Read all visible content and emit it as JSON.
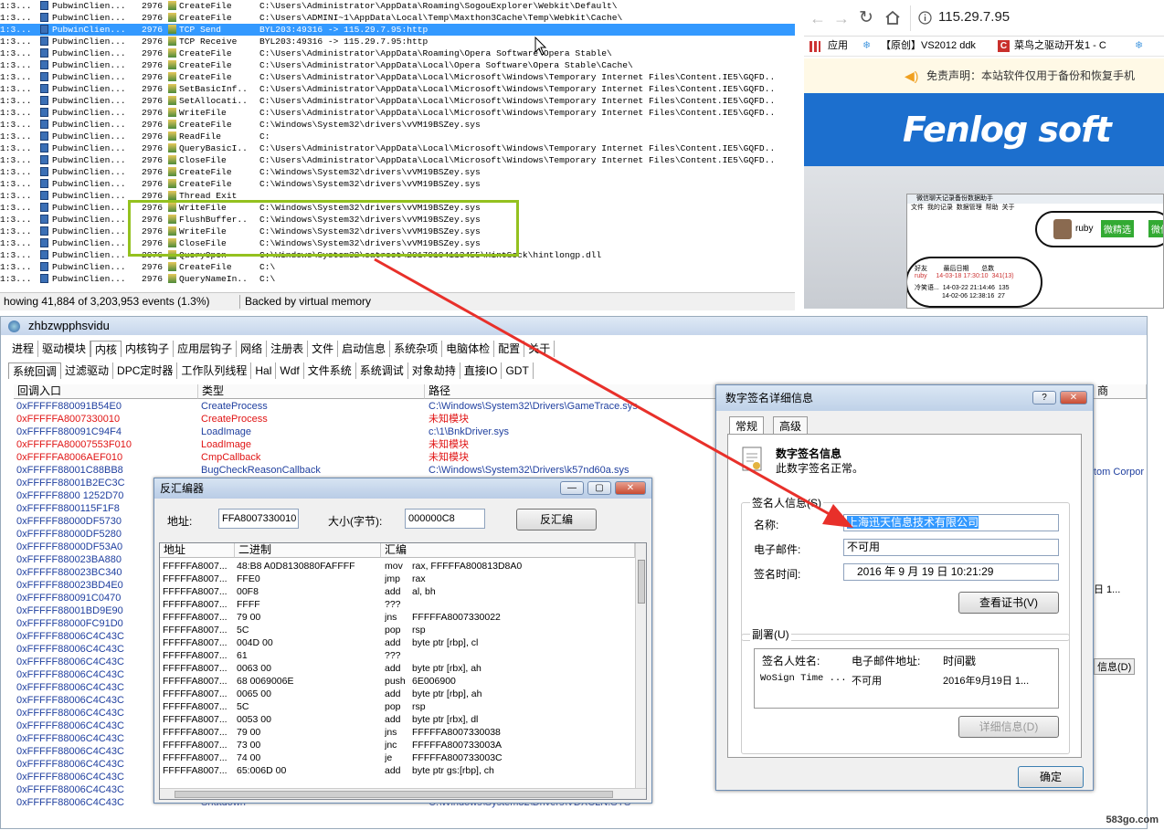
{
  "procmon": {
    "rows": [
      {
        "time": "1:3...",
        "proc": "PubwinClien...",
        "pid": "2976",
        "op": "CreateFile",
        "path": "C:\\Users\\Administrator\\AppData\\Roaming\\SogouExplorer\\Webkit\\Default\\",
        "icon": "file-icon"
      },
      {
        "time": "1:3...",
        "proc": "PubwinClien...",
        "pid": "2976",
        "op": "CreateFile",
        "path": "C:\\Users\\ADMINI~1\\AppData\\Local\\Temp\\Maxthon3Cache\\Temp\\Webkit\\Cache\\",
        "icon": "file-icon"
      },
      {
        "time": "1:3...",
        "proc": "PubwinClien...",
        "pid": "2976",
        "op": "TCP Send",
        "path": "BYL203:49316 -> 115.29.7.95:http",
        "icon": "network-icon",
        "selected": true
      },
      {
        "time": "1:3...",
        "proc": "PubwinClien...",
        "pid": "2976",
        "op": "TCP Receive",
        "path": "BYL203:49316 -> 115.29.7.95:http",
        "icon": "network-icon"
      },
      {
        "time": "1:3...",
        "proc": "PubwinClien...",
        "pid": "2976",
        "op": "CreateFile",
        "path": "C:\\Users\\Administrator\\AppData\\Roaming\\Opera Software\\Opera Stable\\",
        "icon": "file-icon"
      },
      {
        "time": "1:3...",
        "proc": "PubwinClien...",
        "pid": "2976",
        "op": "CreateFile",
        "path": "C:\\Users\\Administrator\\AppData\\Local\\Opera Software\\Opera Stable\\Cache\\",
        "icon": "file-icon"
      },
      {
        "time": "1:3...",
        "proc": "PubwinClien...",
        "pid": "2976",
        "op": "CreateFile",
        "path": "C:\\Users\\Administrator\\AppData\\Local\\Microsoft\\Windows\\Temporary Internet Files\\Content.IE5\\GQFD..",
        "icon": "file-icon"
      },
      {
        "time": "1:3...",
        "proc": "PubwinClien...",
        "pid": "2976",
        "op": "SetBasicInf...",
        "path": "C:\\Users\\Administrator\\AppData\\Local\\Microsoft\\Windows\\Temporary Internet Files\\Content.IE5\\GQFD..",
        "icon": "file-icon"
      },
      {
        "time": "1:3...",
        "proc": "PubwinClien...",
        "pid": "2976",
        "op": "SetAllocati...",
        "path": "C:\\Users\\Administrator\\AppData\\Local\\Microsoft\\Windows\\Temporary Internet Files\\Content.IE5\\GQFD..",
        "icon": "file-icon"
      },
      {
        "time": "1:3...",
        "proc": "PubwinClien...",
        "pid": "2976",
        "op": "WriteFile",
        "path": "C:\\Users\\Administrator\\AppData\\Local\\Microsoft\\Windows\\Temporary Internet Files\\Content.IE5\\GQFD..",
        "icon": "file-icon"
      },
      {
        "time": "1:3...",
        "proc": "PubwinClien...",
        "pid": "2976",
        "op": "CreateFile",
        "path": "C:\\Windows\\System32\\drivers\\vVM19BSZey.sys",
        "icon": "file-icon"
      },
      {
        "time": "1:3...",
        "proc": "PubwinClien...",
        "pid": "2976",
        "op": "ReadFile",
        "path": "C:",
        "icon": "file-icon"
      },
      {
        "time": "1:3...",
        "proc": "PubwinClien...",
        "pid": "2976",
        "op": "QueryBasicI...",
        "path": "C:\\Users\\Administrator\\AppData\\Local\\Microsoft\\Windows\\Temporary Internet Files\\Content.IE5\\GQFD..",
        "icon": "file-icon"
      },
      {
        "time": "1:3...",
        "proc": "PubwinClien...",
        "pid": "2976",
        "op": "CloseFile",
        "path": "C:\\Users\\Administrator\\AppData\\Local\\Microsoft\\Windows\\Temporary Internet Files\\Content.IE5\\GQFD..",
        "icon": "file-icon"
      },
      {
        "time": "1:3...",
        "proc": "PubwinClien...",
        "pid": "2976",
        "op": "CreateFile",
        "path": "C:\\Windows\\System32\\drivers\\vVM19BSZey.sys",
        "icon": "file-icon"
      },
      {
        "time": "1:3...",
        "proc": "PubwinClien...",
        "pid": "2976",
        "op": "CreateFile",
        "path": "C:\\Windows\\System32\\drivers\\vVM19BSZey.sys",
        "icon": "file-icon"
      },
      {
        "time": "1:3...",
        "proc": "PubwinClien...",
        "pid": "2976",
        "op": "Thread Exit",
        "path": "",
        "icon": "thread-icon"
      },
      {
        "time": "1:3...",
        "proc": "PubwinClien...",
        "pid": "2976",
        "op": "WriteFile",
        "path": "C:\\Windows\\System32\\drivers\\vVM19BSZey.sys",
        "icon": "file-icon"
      },
      {
        "time": "1:3...",
        "proc": "PubwinClien...",
        "pid": "2976",
        "op": "FlushBuffer...",
        "path": "C:\\Windows\\System32\\drivers\\vVM19BSZey.sys",
        "icon": "file-icon"
      },
      {
        "time": "1:3...",
        "proc": "PubwinClien...",
        "pid": "2976",
        "op": "WriteFile",
        "path": "C:\\Windows\\System32\\drivers\\vVM19BSZey.sys",
        "icon": "file-icon"
      },
      {
        "time": "1:3...",
        "proc": "PubwinClien...",
        "pid": "2976",
        "op": "CloseFile",
        "path": "C:\\Windows\\System32\\drivers\\vVM19BSZey.sys",
        "icon": "file-icon"
      },
      {
        "time": "1:3...",
        "proc": "PubwinClien...",
        "pid": "2976",
        "op": "QueryOpen",
        "path": "C:\\Windows\\System32\\catroot\\20170104113455\\HintSock\\hintlongp.dll",
        "icon": "file-icon"
      },
      {
        "time": "1:3...",
        "proc": "PubwinClien...",
        "pid": "2976",
        "op": "CreateFile",
        "path": "C:\\",
        "icon": "file-icon"
      },
      {
        "time": "1:3...",
        "proc": "PubwinClien...",
        "pid": "2976",
        "op": "QueryNameIn...",
        "path": "C:\\",
        "icon": "file-icon"
      }
    ],
    "status_events": "howing 41,884 of 3,203,953 events (1.3%)",
    "status_memory": "Backed by virtual memory"
  },
  "browser": {
    "url": "115.29.7.95",
    "bookmarks": [
      "应用",
      "【原创】VS2012 ddk",
      "菜鸟之驱动开发1 - C"
    ],
    "notice": "免责声明：本站软件仅用于备份和恢复手机",
    "brand_logo": "Fenlog soft",
    "shot": {
      "title": "微信聊天记录备份数据助手",
      "menu": [
        "文件",
        "我的记录",
        "数据管理",
        "帮助",
        "关于"
      ],
      "user": "ruby",
      "btn_pick": "微精选",
      "btn_wx": "微信",
      "list_headers": [
        "好友",
        "最后日期",
        "总数"
      ],
      "list_rows": [
        [
          "ruby",
          "14-03-18 17:30:10",
          "341(13)"
        ],
        [
          "冷笑语...",
          "14-03-22 21:14:46",
          "135"
        ],
        [
          "",
          "14-02-06 12:38:16",
          "27"
        ]
      ]
    }
  },
  "tool": {
    "title": "zhbzwpphsvidu",
    "tabs": [
      "进程",
      "驱动模块",
      "内核",
      "内核钩子",
      "应用层钩子",
      "网络",
      "注册表",
      "文件",
      "启动信息",
      "系统杂项",
      "电脑体检",
      "配置",
      "关于"
    ],
    "active_tab": 2,
    "subtabs": [
      "系统回调",
      "过滤驱动",
      "DPC定时器",
      "工作队列线程",
      "Hal",
      "Wdf",
      "文件系统",
      "系统调试",
      "对象劫持",
      "直接IO",
      "GDT"
    ],
    "columns": [
      "回调入口",
      "类型",
      "路径"
    ],
    "rows": [
      {
        "addr": "0xFFFFF880091B54E0",
        "type": "CreateProcess",
        "path": "C:\\Windows\\System32\\Drivers\\GameTrace.sys",
        "red": false
      },
      {
        "addr": "0xFFFFFA8007330010",
        "type": "CreateProcess",
        "path": "未知模块",
        "red": true
      },
      {
        "addr": "0xFFFFF880091C94F4",
        "type": "LoadImage",
        "path": "c:\\1\\BnkDriver.sys",
        "red": false
      },
      {
        "addr": "0xFFFFFA80007553F010",
        "type": "LoadImage",
        "path": "未知模块",
        "red": true
      },
      {
        "addr": "0xFFFFFA8006AEF010",
        "type": "CmpCallback",
        "path": "未知模块",
        "red": true
      },
      {
        "addr": "0xFFFFF88001C88BB8",
        "type": "BugCheckReasonCallback",
        "path": "C:\\Windows\\System32\\Drivers\\k57nd60a.sys",
        "red": false
      },
      {
        "addr": "0xFFFFF88001B2EC3C",
        "type": "",
        "path": "",
        "red": false
      },
      {
        "addr": "0xFFFFF8800 1252D70",
        "type": "",
        "path": "",
        "red": false
      },
      {
        "addr": "0xFFFFF8800115F1F8",
        "type": "",
        "path": "",
        "red": false
      },
      {
        "addr": "0xFFFFF88000DF5730",
        "type": "",
        "path": "",
        "red": false
      },
      {
        "addr": "0xFFFFF88000DF5280",
        "type": "",
        "path": "",
        "red": false
      },
      {
        "addr": "0xFFFFF88000DF53A0",
        "type": "",
        "path": "",
        "red": false
      },
      {
        "addr": "0xFFFFF880023BA880",
        "type": "",
        "path": "",
        "red": false
      },
      {
        "addr": "0xFFFFF880023BC340",
        "type": "",
        "path": "",
        "red": false
      },
      {
        "addr": "0xFFFFF880023BD4E0",
        "type": "",
        "path": "",
        "red": false
      },
      {
        "addr": "0xFFFFF880091C0470",
        "type": "",
        "path": "",
        "red": false
      },
      {
        "addr": "0xFFFFF88001BD9E90",
        "type": "",
        "path": "",
        "red": false
      },
      {
        "addr": "0xFFFFF88000FC91D0",
        "type": "",
        "path": "",
        "red": false
      },
      {
        "addr": "0xFFFFF88006C4C43C",
        "type": "",
        "path": "",
        "red": false
      },
      {
        "addr": "0xFFFFF88006C4C43C",
        "type": "",
        "path": "",
        "red": false
      },
      {
        "addr": "0xFFFFF88006C4C43C",
        "type": "",
        "path": "",
        "red": false
      },
      {
        "addr": "0xFFFFF88006C4C43C",
        "type": "",
        "path": "",
        "red": false
      },
      {
        "addr": "0xFFFFF88006C4C43C",
        "type": "",
        "path": "",
        "red": false
      },
      {
        "addr": "0xFFFFF88006C4C43C",
        "type": "",
        "path": "",
        "red": false
      },
      {
        "addr": "0xFFFFF88006C4C43C",
        "type": "",
        "path": "",
        "red": false
      },
      {
        "addr": "0xFFFFF88006C4C43C",
        "type": "",
        "path": "",
        "red": false
      },
      {
        "addr": "0xFFFFF88006C4C43C",
        "type": "",
        "path": "",
        "red": false
      },
      {
        "addr": "0xFFFFF88006C4C43C",
        "type": "",
        "path": "",
        "red": false
      },
      {
        "addr": "0xFFFFF88006C4C43C",
        "type": "",
        "path": "",
        "red": false
      },
      {
        "addr": "0xFFFFF88006C4C43C",
        "type": "",
        "path": "",
        "red": false
      },
      {
        "addr": "0xFFFFF88006C4C43C",
        "type": "",
        "path": "",
        "red": false
      },
      {
        "addr": "0xFFFFF88006C4C43C",
        "type": "Shutdown",
        "path": "C:\\Windows\\System32\\Drivers\\VDXCLN.SYS",
        "red": false
      }
    ],
    "right_partial": {
      "col_header": "商",
      "row5": "tom Corpor",
      "row_date": "日 1...",
      "btn_info": "信息(D)"
    }
  },
  "disasm": {
    "title": "反汇编器",
    "addr_label": "地址:",
    "addr_value": "FFA8007330010",
    "size_label": "大小(字节):",
    "size_value": "000000C8",
    "button": "反汇编",
    "columns": [
      "地址",
      "二进制",
      "汇编"
    ],
    "rows": [
      [
        "FFFFFA8007...",
        "48:B8 A0D8130880FAFFFF",
        "mov",
        "rax, FFFFFA800813D8A0"
      ],
      [
        "FFFFFA8007...",
        "FFE0",
        "jmp",
        "rax"
      ],
      [
        "FFFFFA8007...",
        "00F8",
        "add",
        "al, bh"
      ],
      [
        "FFFFFA8007...",
        "FFFF",
        "???",
        ""
      ],
      [
        "FFFFFA8007...",
        "79 00",
        "jns",
        "FFFFFA8007330022"
      ],
      [
        "FFFFFA8007...",
        "5C",
        "pop",
        "rsp"
      ],
      [
        "FFFFFA8007...",
        "004D 00",
        "add",
        "byte ptr [rbp], cl"
      ],
      [
        "FFFFFA8007...",
        "61",
        "???",
        ""
      ],
      [
        "FFFFFA8007...",
        "0063 00",
        "add",
        "byte ptr [rbx], ah"
      ],
      [
        "FFFFFA8007...",
        "68 0069006E",
        "push",
        "6E006900"
      ],
      [
        "FFFFFA8007...",
        "0065 00",
        "add",
        "byte ptr [rbp], ah"
      ],
      [
        "FFFFFA8007...",
        "5C",
        "pop",
        "rsp"
      ],
      [
        "FFFFFA8007...",
        "0053 00",
        "add",
        "byte ptr [rbx], dl"
      ],
      [
        "FFFFFA8007...",
        "79 00",
        "jns",
        "FFFFFA8007330038"
      ],
      [
        "FFFFFA8007...",
        "73 00",
        "jnc",
        "FFFFFA800733003A"
      ],
      [
        "FFFFFA8007...",
        "74 00",
        "je",
        "FFFFFA800733003C"
      ],
      [
        "FFFFFA8007...",
        "65:006D 00",
        "add",
        "byte ptr gs:[rbp], ch"
      ]
    ]
  },
  "sig": {
    "title": "数字签名详细信息",
    "tabs": [
      "常规",
      "高级"
    ],
    "header": "数字签名信息",
    "sub": "此数字签名正常。",
    "signer_group": "签名人信息(S)",
    "name_label": "名称:",
    "name_value": "上海迅天信息技术有限公司",
    "email_label": "电子邮件:",
    "email_value": "不可用",
    "time_label": "签名时间:",
    "time_value": "2016 年 9 月 19 日 10:21:29",
    "view_cert": "查看证书(V)",
    "counter_group": "副署(U)",
    "cs_cols": [
      "签名人姓名:",
      "电子邮件地址:",
      "时间戳"
    ],
    "cs_row": [
      "WoSign Time ...",
      "不可用",
      "2016年9月19日 1..."
    ],
    "details_btn": "详细信息(D)",
    "ok": "确定",
    "help": "?"
  },
  "watermark": "583go.com"
}
